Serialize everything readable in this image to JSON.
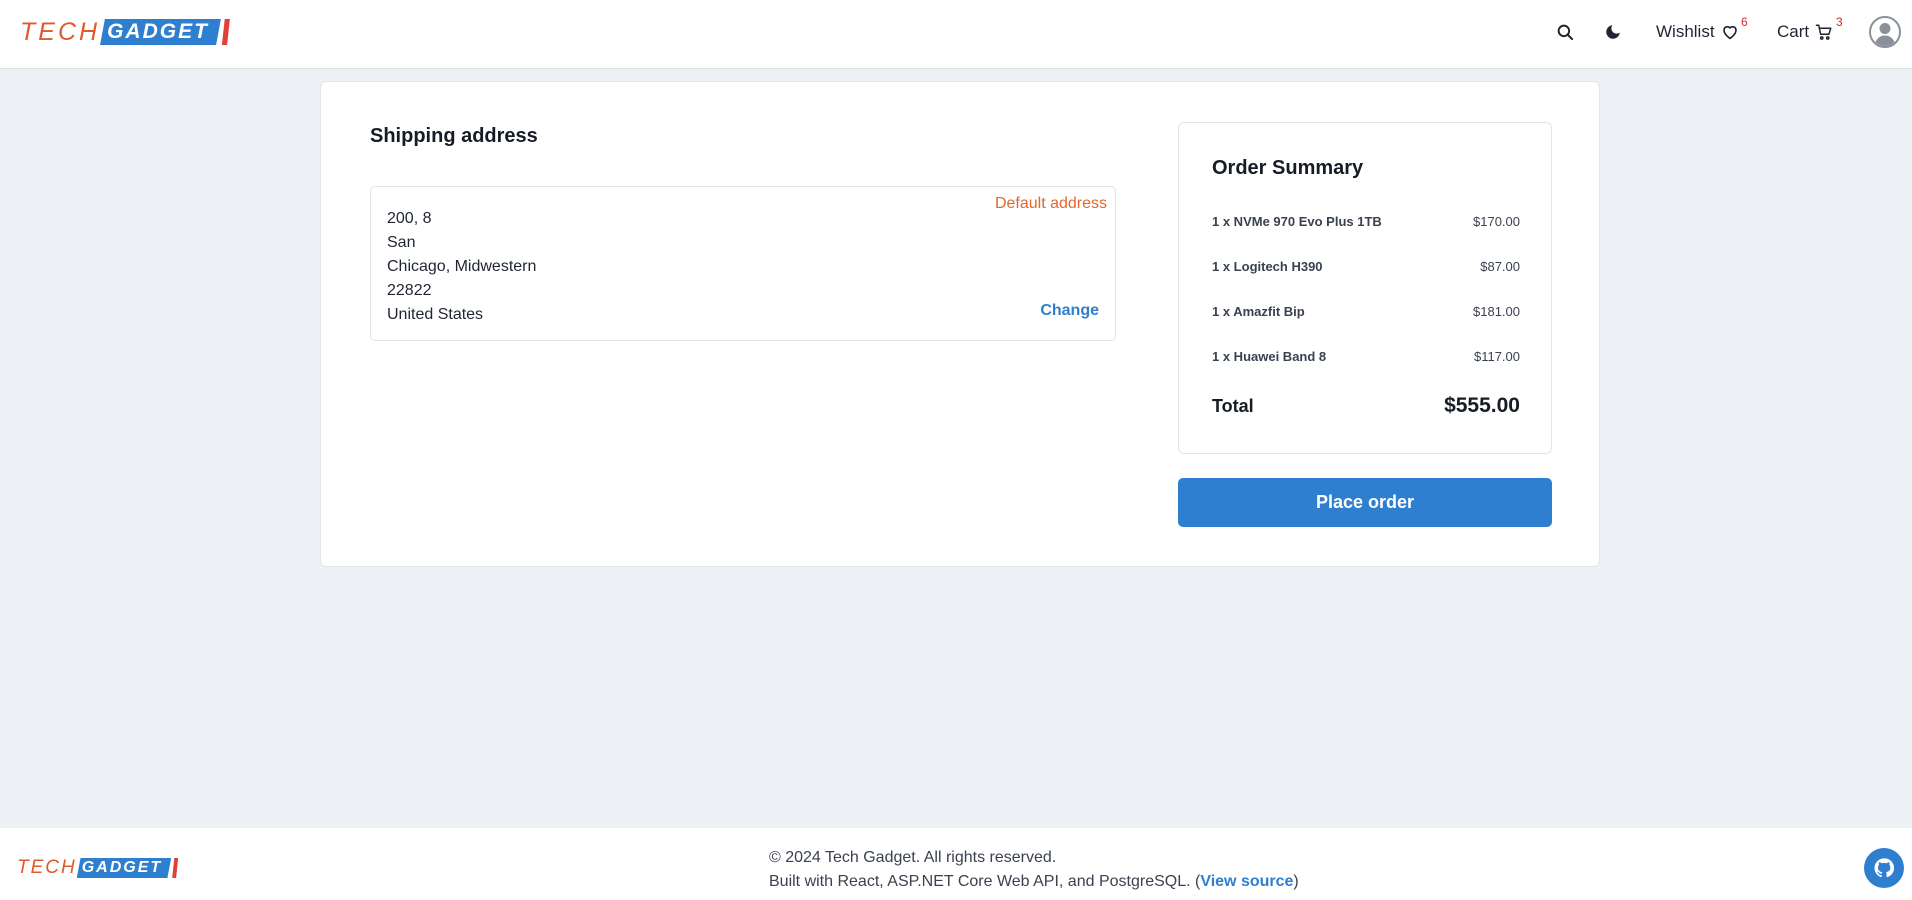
{
  "brand": {
    "part1": "TECH",
    "part2": "GADGET"
  },
  "header": {
    "wishlist_label": "Wishlist",
    "wishlist_count": "6",
    "cart_label": "Cart",
    "cart_count": "3",
    "icons": [
      "search-icon",
      "moon-icon",
      "heart-icon",
      "cart-icon",
      "user-avatar-icon"
    ]
  },
  "shipping": {
    "title": "Shipping address",
    "default_label": "Default address",
    "lines": [
      "200, 8",
      "San",
      "Chicago, Midwestern",
      "22822",
      "United States"
    ],
    "change_label": "Change"
  },
  "summary": {
    "title": "Order Summary",
    "items": [
      {
        "name": "1 x NVMe 970 Evo Plus 1TB",
        "price": "$170.00"
      },
      {
        "name": "1 x Logitech H390",
        "price": "$87.00"
      },
      {
        "name": "1 x Amazfit Bip",
        "price": "$181.00"
      },
      {
        "name": "1 x Huawei Band 8",
        "price": "$117.00"
      }
    ],
    "total_label": "Total",
    "total_value": "$555.00"
  },
  "place_order_label": "Place order",
  "footer": {
    "copyright": "© 2024 Tech Gadget. All rights reserved.",
    "built_prefix": "Built with React, ASP.NET Core Web API, and PostgreSQL. (",
    "view_source": "View source",
    "built_suffix": ")"
  },
  "colors": {
    "accent": "#2f7fd0",
    "brand_orange": "#e05a2b",
    "brand_red": "#e0413a",
    "badge_red": "#e02424",
    "page_bg": "#edf1f5"
  }
}
